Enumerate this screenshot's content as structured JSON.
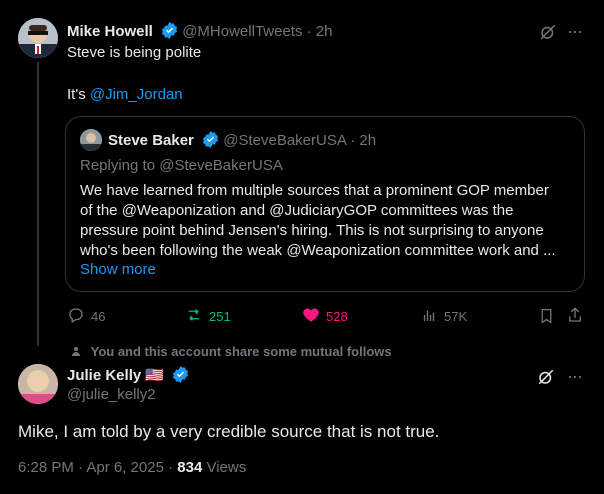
{
  "post": {
    "author_name": "Mike Howell",
    "author_handle": "@MHowellTweets",
    "time": "· 2h",
    "line1": "Steve is being polite",
    "line2_prefix": "It's ",
    "line2_mention": "@Jim_Jordan"
  },
  "quote": {
    "author_name": "Steve Baker",
    "author_handle": "@SteveBakerUSA",
    "time": "· 2h",
    "replying_to": "Replying to @SteveBakerUSA",
    "text_l1": "We have learned from multiple sources that a prominent GOP member",
    "text_l2": "of the @Weaponization and @JudiciaryGOP committees was the",
    "text_l3": "pressure point behind Jensen's hiring. This is not surprising to anyone",
    "text_l4": "who's been following the weak @Weaponization committee work and ...",
    "show_more": "Show more"
  },
  "actions": {
    "replies": "46",
    "reposts": "251",
    "likes": "528",
    "views": "57K"
  },
  "mutual_notice": "You and this account share some mutual follows",
  "reply": {
    "author_name": "Julie Kelly",
    "flag": "🇺🇸",
    "author_handle": "@julie_kelly2",
    "text": "Mike, I am told by a very credible source that is not true.",
    "timestamp": "6:28 PM · Apr 6, 2025 · ",
    "views_count": "834",
    "views_label": " Views"
  },
  "colors": {
    "background": "#000000",
    "text": "#e7e9ea",
    "muted": "#71767b",
    "link": "#1d9bf0",
    "repost_active": "#00ba7c",
    "like_active": "#f91880",
    "border": "#2f3336"
  }
}
